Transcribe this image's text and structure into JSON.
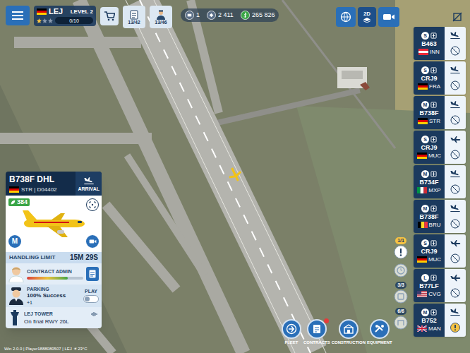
{
  "airport": {
    "flag": "de",
    "code": "LEJ",
    "stars": 1,
    "level": "LEVEL 2",
    "progress": "0/10",
    "progress_level": 0
  },
  "top_buttons": [
    {
      "kind": "orders",
      "value": "13/42"
    },
    {
      "kind": "staff",
      "value": "13/46"
    }
  ],
  "resources": [
    {
      "kind": "tickets",
      "value": "1"
    },
    {
      "kind": "gems",
      "value": "2 411"
    },
    {
      "kind": "money",
      "value": "265 826"
    }
  ],
  "view_mode": "2D",
  "flight_card": {
    "title": "B738F DHL",
    "direction": "ARRIVAL",
    "origin_flag": "de",
    "route": "STR | D04402",
    "score": "384",
    "category": "M",
    "limit_label": "HANDLING LIMIT",
    "limit_time": "15M 29S",
    "admin_label": "CONTRACT ADMIN",
    "admin_level": 0.72,
    "parking_label": "PARKING",
    "parking_success": "100% Success",
    "parking_bonus": "+1",
    "play_label": "PLAY",
    "play_on": false,
    "tower_label": "LEJ TOWER",
    "tower_message": "On final RWY 26L"
  },
  "flights": [
    {
      "category": "S",
      "type": "B463",
      "country": "at",
      "code": "INN",
      "phase": "landing",
      "alert": false
    },
    {
      "category": "S",
      "type": "CRJ9",
      "country": "de",
      "code": "FRA",
      "phase": "landing",
      "alert": false
    },
    {
      "category": "M",
      "type": "B738F",
      "country": "de",
      "code": "STR",
      "phase": "landing",
      "alert": false
    },
    {
      "category": "S",
      "type": "CRJ9",
      "country": "de",
      "code": "MUC",
      "phase": "airborne",
      "alert": false
    },
    {
      "category": "M",
      "type": "B734F",
      "country": "it",
      "code": "MXP",
      "phase": "landing",
      "alert": false
    },
    {
      "category": "M",
      "type": "B738F",
      "country": "be",
      "code": "BRU",
      "phase": "landing",
      "alert": false
    },
    {
      "category": "S",
      "type": "CRJ9",
      "country": "de",
      "code": "MUC",
      "phase": "airborne",
      "alert": false
    },
    {
      "category": "L",
      "type": "B77LF",
      "country": "us",
      "code": "CVG",
      "phase": "airborne",
      "alert": false
    },
    {
      "category": "M",
      "type": "B752",
      "country": "gb",
      "code": "MAN",
      "phase": "landing",
      "alert": true
    }
  ],
  "side_badges": [
    {
      "kind": "alert",
      "count": "1/1"
    },
    {
      "kind": "timer"
    },
    {
      "kind": "stand",
      "count": "3/3"
    },
    {
      "kind": "gate",
      "count": "6/6"
    }
  ],
  "toolbar": [
    {
      "kind": "fleet",
      "label": "FLEET",
      "alert": false
    },
    {
      "kind": "contracts",
      "label": "CONTRACTS",
      "alert": true
    },
    {
      "kind": "construction",
      "label": "CONSTRUCTION",
      "alert": false
    },
    {
      "kind": "equipment",
      "label": "EQUIPMENT",
      "alert": false
    }
  ],
  "footer": "Win 2.0.0 | Player1888080507 | LEJ ☀ 23°C"
}
